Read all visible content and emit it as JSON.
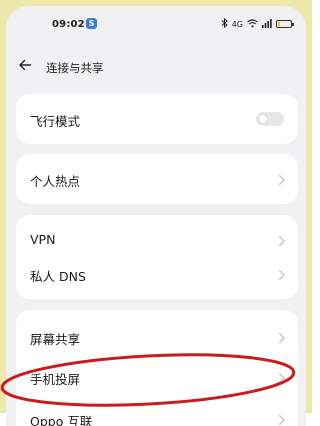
{
  "status_bar": {
    "time": "09:02",
    "badge_letter": "S",
    "signal_text": "4G",
    "battery_level_percent": 20,
    "icons": [
      "bluetooth-icon",
      "wifi-icon",
      "signal-icon",
      "battery-icon"
    ]
  },
  "header": {
    "back_icon": "arrow-left-icon",
    "title": "连接与共享"
  },
  "sections": [
    {
      "items": [
        {
          "label": "飞行模式",
          "control": "toggle",
          "on": false
        }
      ]
    },
    {
      "items": [
        {
          "label": "个人热点",
          "control": "chevron"
        }
      ]
    },
    {
      "items": [
        {
          "label": "VPN",
          "control": "chevron"
        },
        {
          "label": "私人 DNS",
          "control": "chevron"
        }
      ]
    },
    {
      "items": [
        {
          "label": "屏幕共享",
          "control": "chevron"
        },
        {
          "label": "手机投屏",
          "control": "chevron",
          "highlighted": true
        },
        {
          "label": "Oppo 互联",
          "control": "chevron"
        }
      ]
    }
  ],
  "colors": {
    "page_bg": "#f1f1f3",
    "card_bg": "#ffffff",
    "highlight_ring": "#cc1b1b",
    "frame_bg": "#ece7aa"
  }
}
